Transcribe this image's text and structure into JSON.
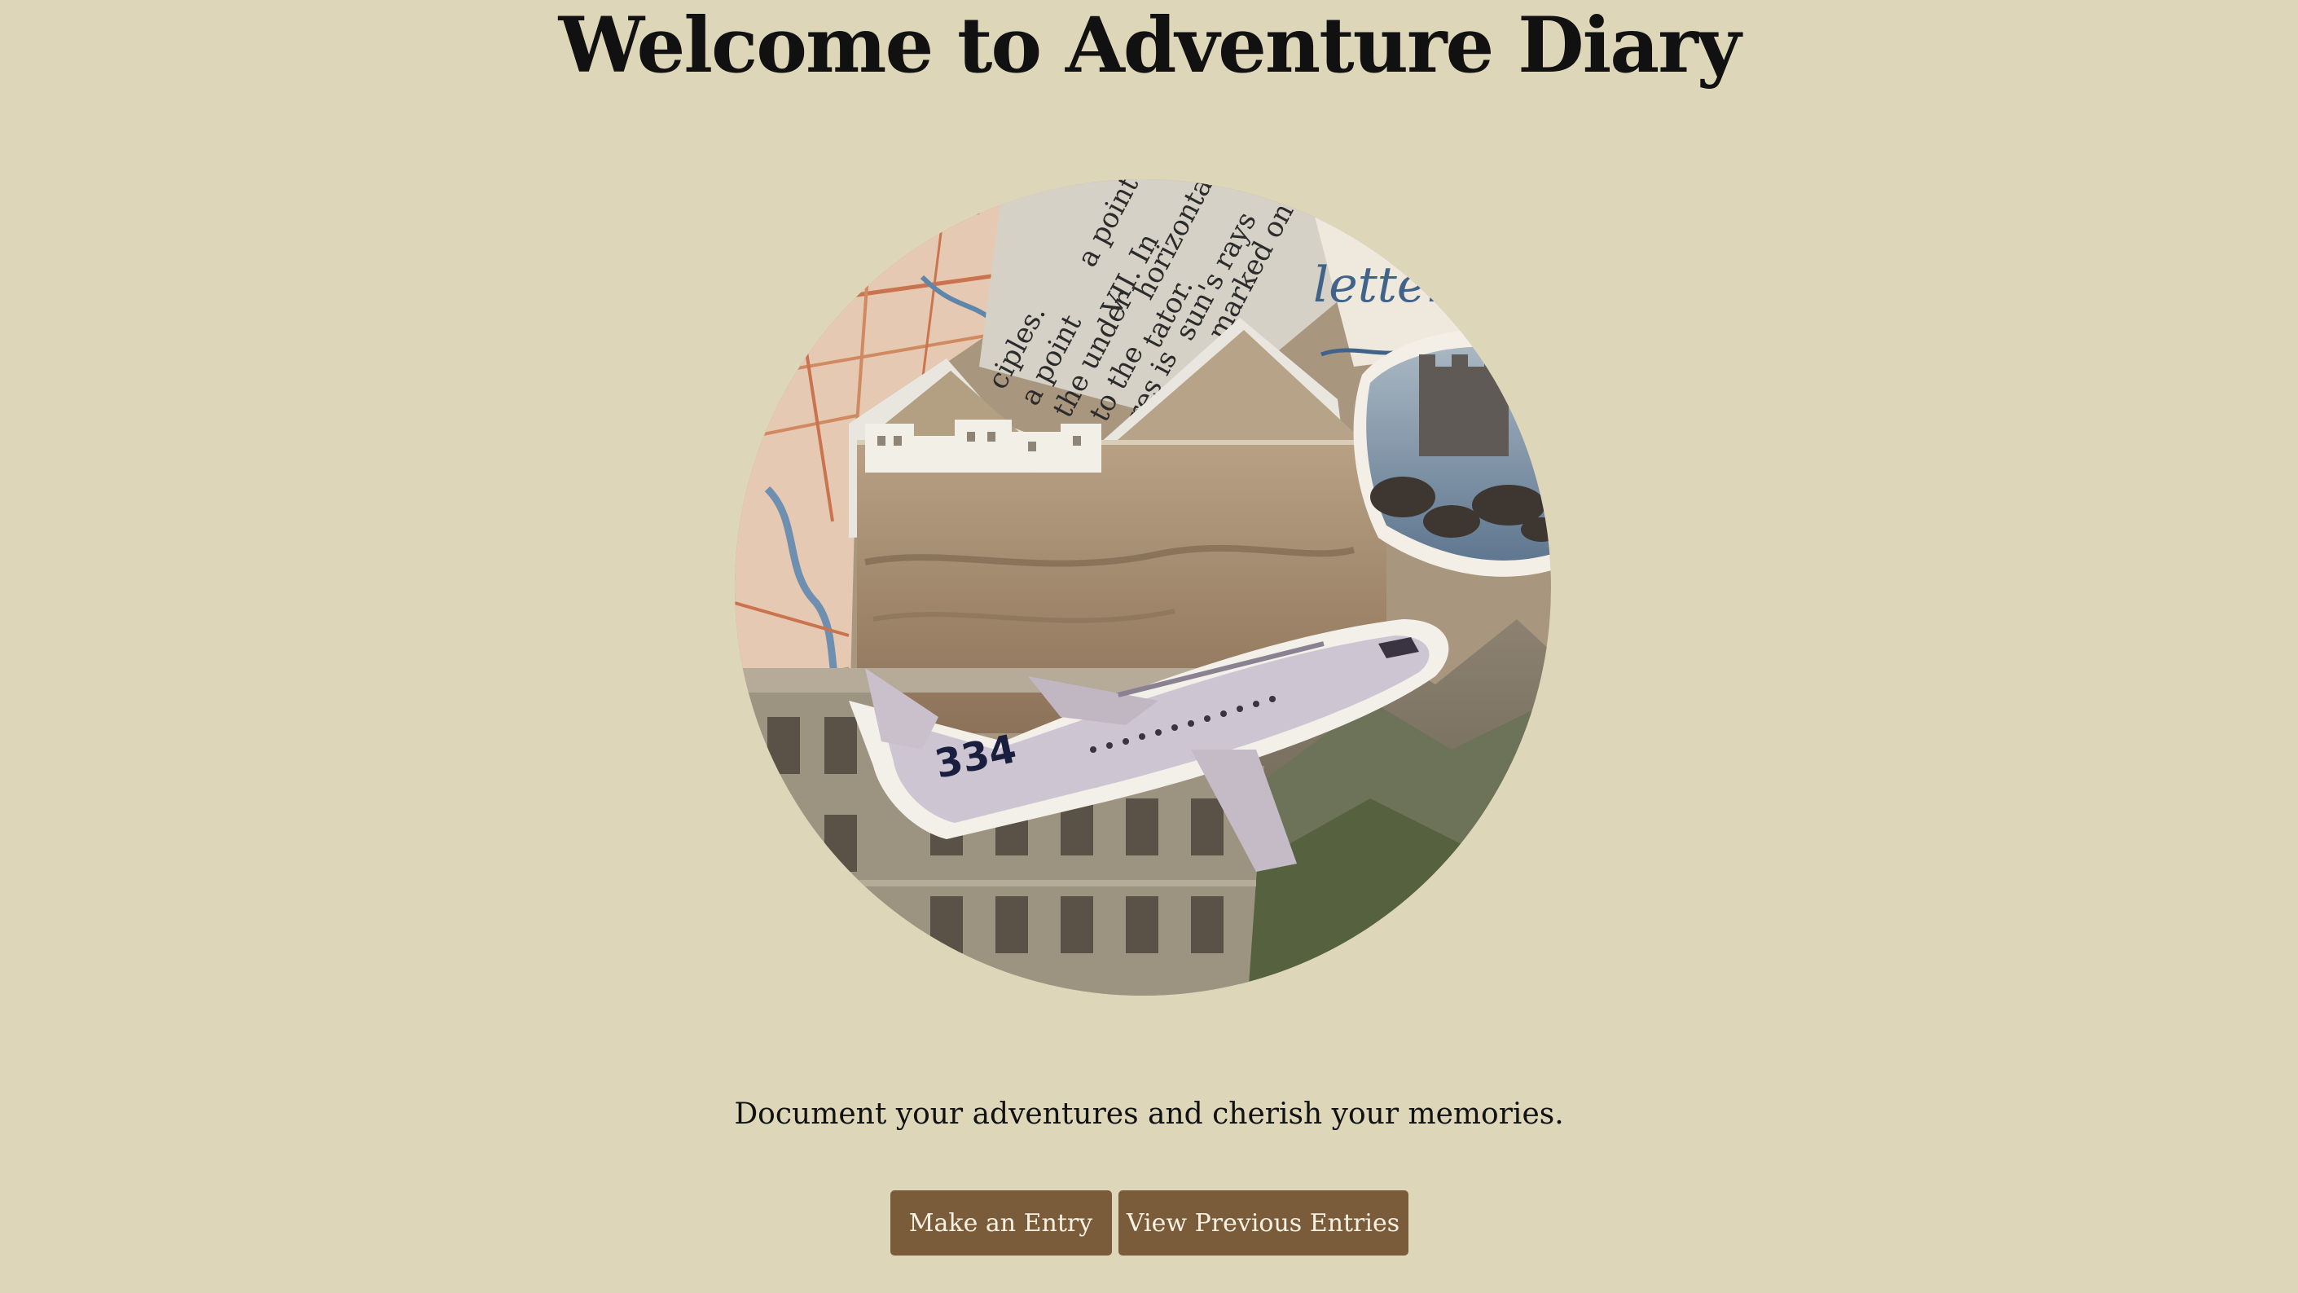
{
  "page": {
    "title": "Welcome to Adventure Diary",
    "tagline": "Document your adventures and cherish your memories."
  },
  "actions": {
    "make_entry_label": "Make an Entry",
    "view_entries_label": "View Previous Entries"
  },
  "collage": {
    "newsprint_lines": [
      "VII. In",
      "a point",
      "horizonta",
      "tator.",
      "sun's rays",
      "marked on",
      "ciples.",
      "a point",
      "the under",
      "to the",
      "res is"
    ],
    "script_text": "letter",
    "aircraft_marking": "334"
  },
  "colors": {
    "background": "#ded6b9",
    "button": "#7a5c3b",
    "button_text": "#f7f1e3"
  }
}
